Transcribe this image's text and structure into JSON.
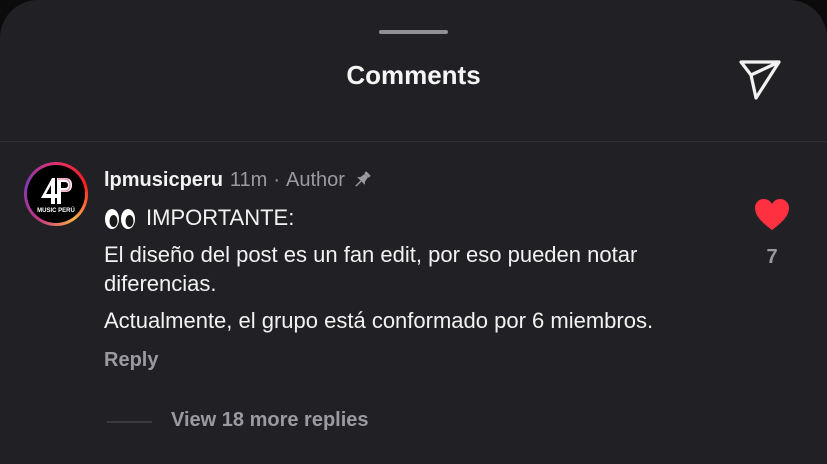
{
  "header": {
    "title": "Comments",
    "share_icon": "send-paper-plane-icon"
  },
  "comment": {
    "avatar": {
      "logo_text": "4P",
      "logo_subtext": "MUSIC PERÚ",
      "ring_colors": [
        "#e1306c",
        "#fcaf45",
        "#833ab4"
      ]
    },
    "username": "lpmusicperu",
    "time": "11m",
    "separator": "·",
    "author_label": "Author",
    "pin_icon": "pin-icon",
    "emoji_icon": "eyes-emoji-icon",
    "lines": [
      "IMPORTANTE:",
      "El diseño del post es un fan edit, por eso pueden notar diferencias.",
      "Actualmente, el grupo está conformado por 6 miembros."
    ],
    "reply_label": "Reply",
    "like_icon": "heart-filled-icon",
    "like_color": "#ff3040",
    "like_count": "7",
    "view_replies_label": "View 18 more replies"
  }
}
